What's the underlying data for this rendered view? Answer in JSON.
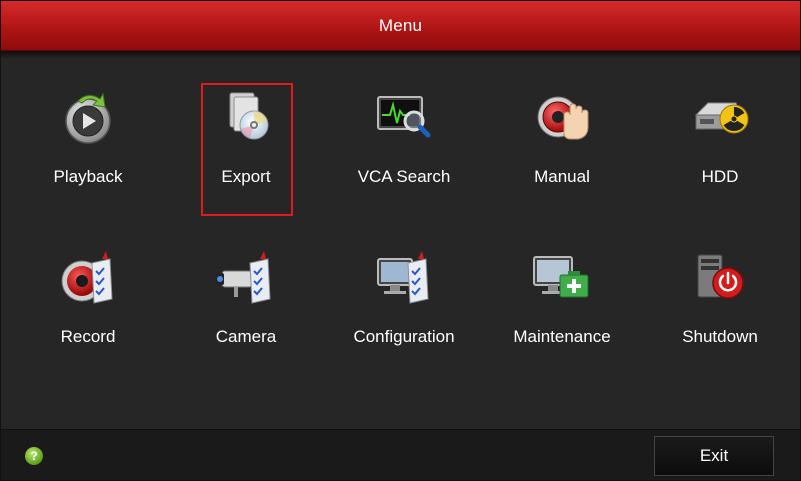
{
  "window": {
    "title": "Menu"
  },
  "menu": {
    "items": [
      {
        "label": "Playback",
        "icon": "playback-icon"
      },
      {
        "label": "Export",
        "icon": "export-disc-icon",
        "selected": true
      },
      {
        "label": "VCA Search",
        "icon": "vca-search-icon"
      },
      {
        "label": "Manual",
        "icon": "manual-hand-icon"
      },
      {
        "label": "HDD",
        "icon": "hdd-icon"
      },
      {
        "label": "Record",
        "icon": "record-icon"
      },
      {
        "label": "Camera",
        "icon": "camera-icon"
      },
      {
        "label": "Configuration",
        "icon": "configuration-icon"
      },
      {
        "label": "Maintenance",
        "icon": "maintenance-icon"
      },
      {
        "label": "Shutdown",
        "icon": "shutdown-icon"
      }
    ]
  },
  "footer": {
    "help_glyph": "?",
    "exit_label": "Exit"
  },
  "colors": {
    "title_bar": "#b11515",
    "background": "#262626",
    "selection": "#e01b1b"
  }
}
